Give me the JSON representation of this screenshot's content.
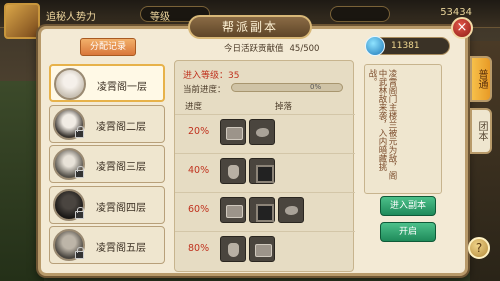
{
  "background": {
    "player_label": "追秘人势力",
    "level_label": "等级",
    "top_number": "53434"
  },
  "panel": {
    "title": "帮派副本",
    "close_icon": "×",
    "alloc_button": "分配记录",
    "activity_label": "今日活跃贡献值",
    "activity_value": "45/500",
    "gem_value": "11381"
  },
  "floors": [
    {
      "name": "凌霄阁一层"
    },
    {
      "name": "凌霄阁二层"
    },
    {
      "name": "凌霄阁三层"
    },
    {
      "name": "凌霄阁四层"
    },
    {
      "name": "凌霄阁五层"
    }
  ],
  "detail": {
    "level_label": "进入等级：35",
    "progress_label": "当前进度：",
    "progress_text": "0%",
    "progress_fraction": 0,
    "col_progress": "进度",
    "col_drops": "掉落",
    "rows": [
      {
        "pct": "20%",
        "items": [
          "chest",
          "ore"
        ]
      },
      {
        "pct": "40%",
        "items": [
          "pot",
          "gift"
        ]
      },
      {
        "pct": "60%",
        "items": [
          "chest",
          "gift",
          "ore"
        ]
      },
      {
        "pct": "80%",
        "items": [
          "pot",
          "chest"
        ]
      }
    ]
  },
  "description": "凌霄阁门主楼兰被元为敌，阁中武林敌来袭，入内暗藏挑战。",
  "buttons": {
    "enter": "进入副本",
    "open": "开启"
  },
  "tabs": {
    "normal": "普通",
    "team": "团本"
  },
  "help_icon": "?"
}
